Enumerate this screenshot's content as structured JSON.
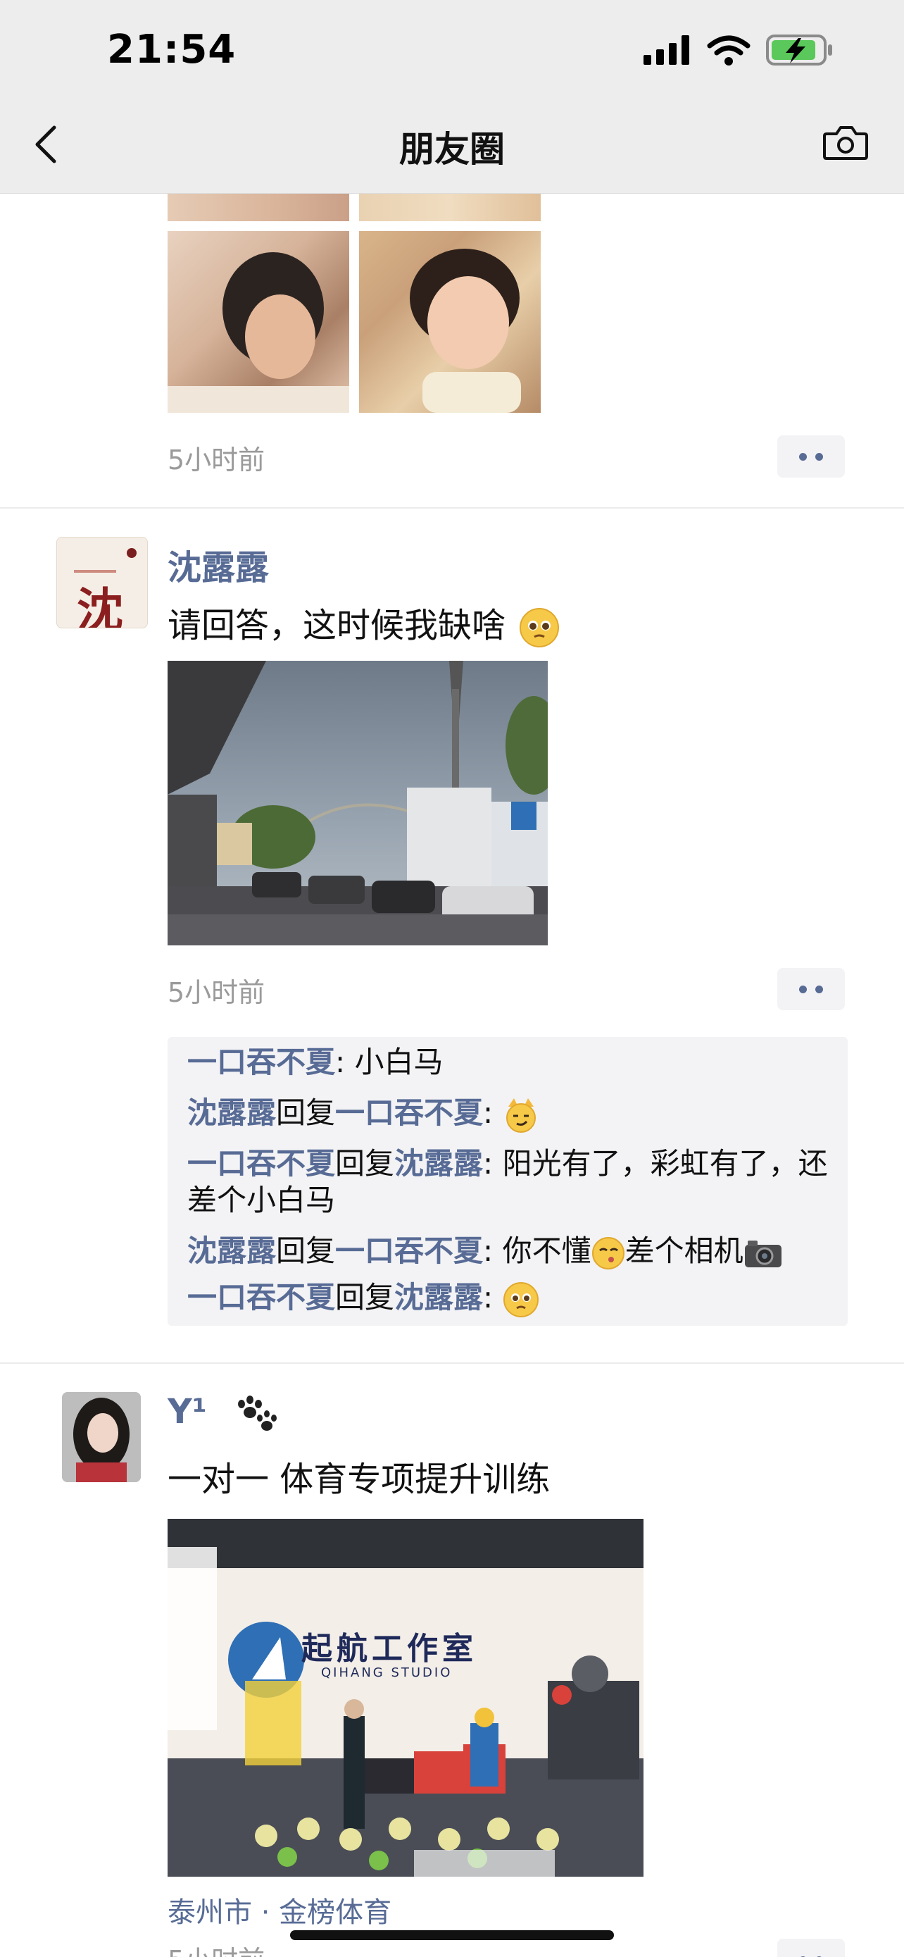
{
  "status_bar": {
    "time": "21:54"
  },
  "nav": {
    "title": "朋友圈"
  },
  "posts": [
    {
      "timestamp": "5小时前"
    },
    {
      "username": "沈露露",
      "avatar_text": "沈",
      "text": "请回答，这时候我缺啥",
      "timestamp": "5小时前",
      "comments": [
        {
          "from": "一口吞不夏",
          "to": "",
          "sep": ": ",
          "text": "小白马"
        },
        {
          "from": "沈露露",
          "reply": "回复",
          "to": "一口吞不夏",
          "sep": ": ",
          "text": ""
        },
        {
          "from": "一口吞不夏",
          "reply": "回复",
          "to": "沈露露",
          "sep": ": ",
          "text": "阳光有了，彩虹有了，还差个小白马"
        },
        {
          "from": "沈露露",
          "reply": "回复",
          "to": "一口吞不夏",
          "sep": ": ",
          "text_a": "你不懂",
          "text_b": "差个相机"
        },
        {
          "from": "一口吞不夏",
          "reply": "回复",
          "to": "沈露露",
          "sep": ": ",
          "text": ""
        }
      ]
    },
    {
      "username": "Y¹",
      "text": "一对一 体育专项提升训练",
      "photo_text": {
        "studio_cn": "起航工作室",
        "studio_en": "QIHANG STUDIO"
      },
      "location": "泰州市 · 金榜体育",
      "timestamp": "5小时前"
    }
  ],
  "colors": {
    "link": "#576b95",
    "timestamp": "#9a9a9a",
    "bar": "#ededed"
  }
}
